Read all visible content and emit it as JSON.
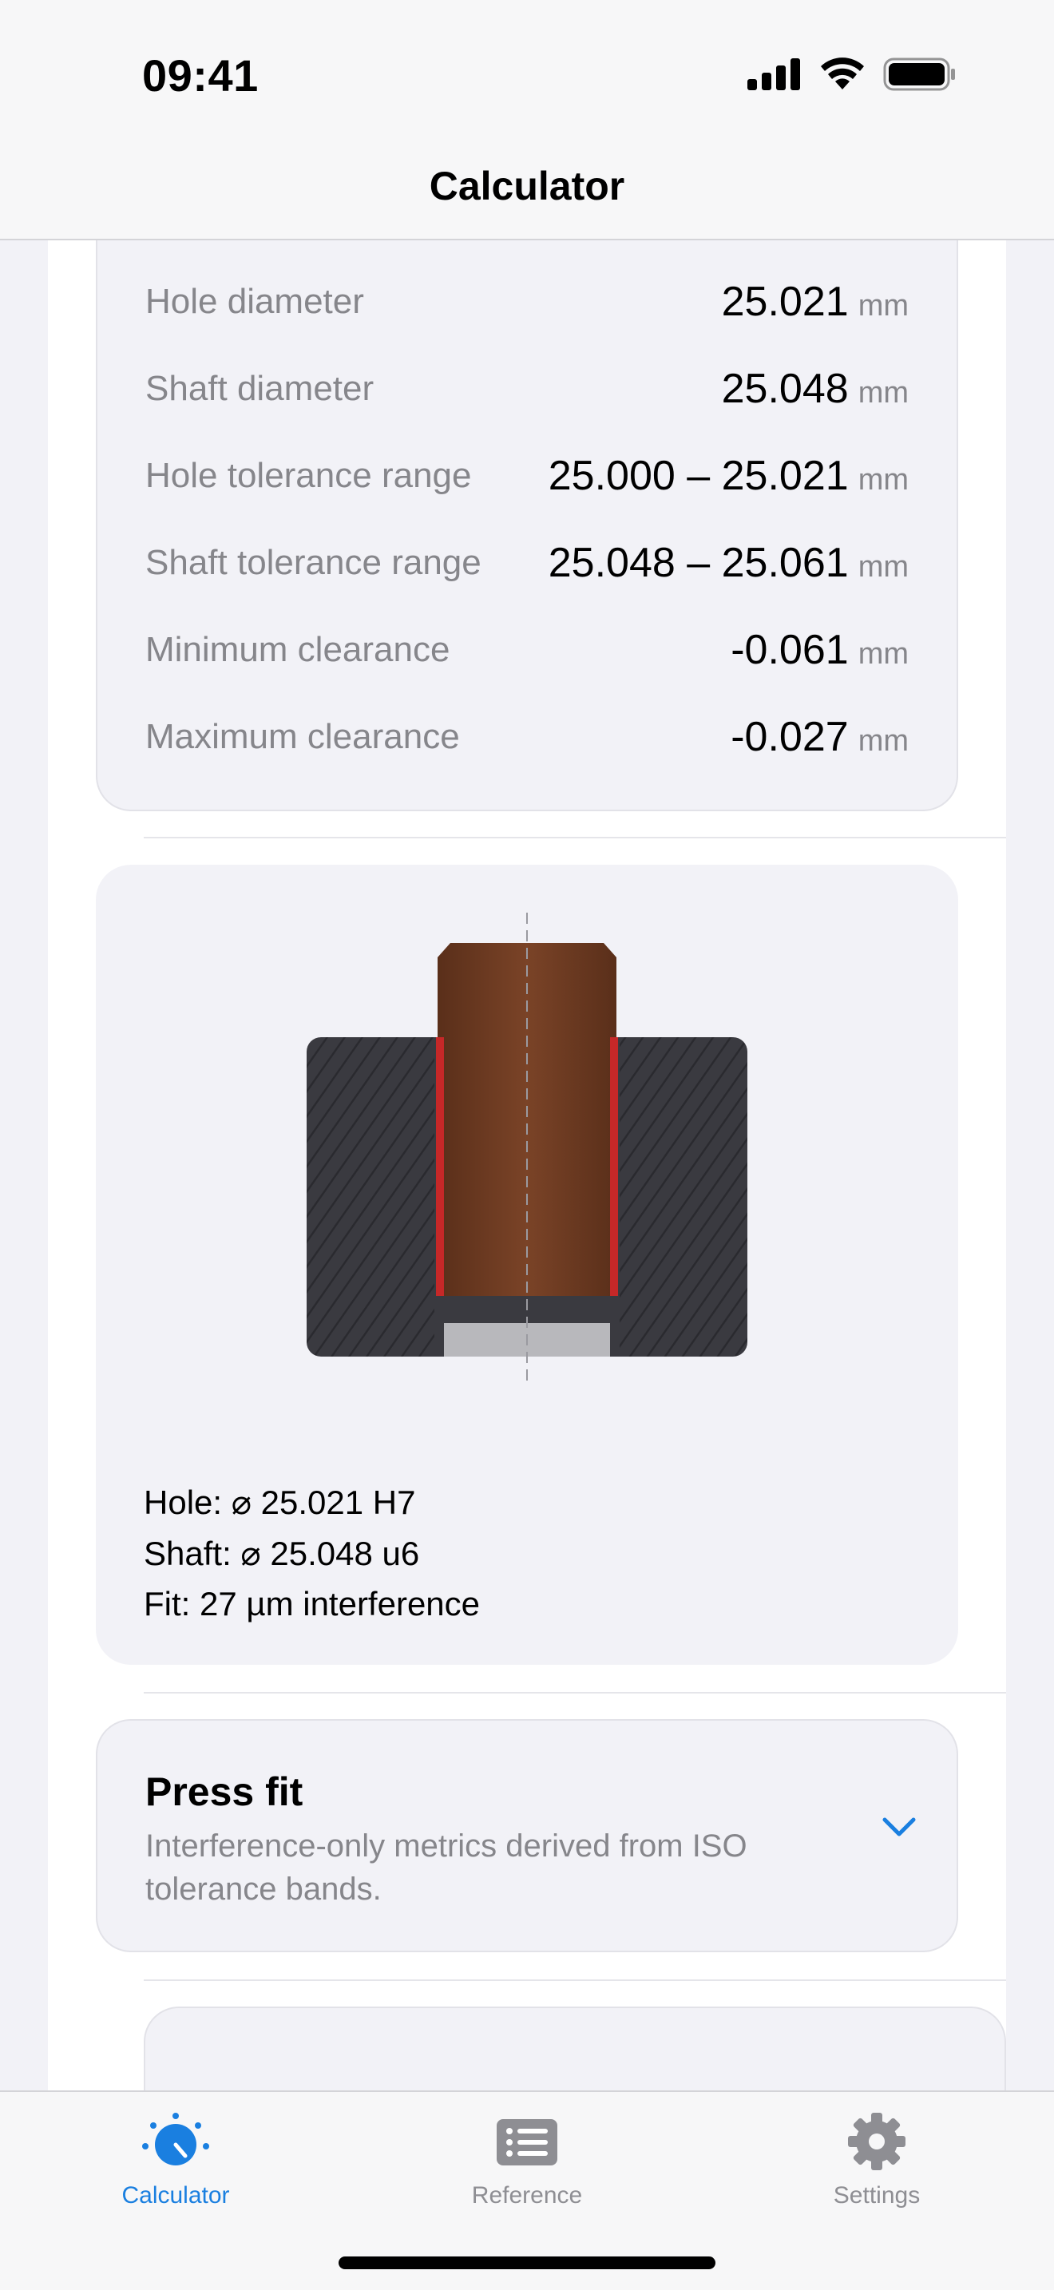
{
  "status_bar": {
    "time": "09:41"
  },
  "nav": {
    "title": "Calculator"
  },
  "results": [
    {
      "label": "Hole diameter",
      "value": "25.021",
      "unit": "mm"
    },
    {
      "label": "Shaft diameter",
      "value": "25.048",
      "unit": "mm"
    },
    {
      "label": "Hole tolerance range",
      "value": "25.000 – 25.021",
      "unit": "mm"
    },
    {
      "label": "Shaft tolerance range",
      "value": "25.048 – 25.061",
      "unit": "mm"
    },
    {
      "label": "Minimum clearance",
      "value": "-0.061",
      "unit": "mm"
    },
    {
      "label": "Maximum clearance",
      "value": "-0.027",
      "unit": "mm"
    }
  ],
  "diagram": {
    "captions": {
      "hole": "Hole: ⌀ 25.021 H7",
      "shaft": "Shaft: ⌀ 25.048 u6",
      "fit": "Fit: 27 µm interference"
    },
    "colors": {
      "housing": "#3a3a40",
      "shaft": "#6b3a22",
      "interference": "#c62828",
      "base": "#b8b8bc"
    }
  },
  "press_fit": {
    "title": "Press fit",
    "description": "Interference-only metrics derived from ISO tolerance bands."
  },
  "tabbar": {
    "tabs": [
      {
        "label": "Calculator",
        "icon": "gauge-icon",
        "active": true
      },
      {
        "label": "Reference",
        "icon": "list-icon",
        "active": false
      },
      {
        "label": "Settings",
        "icon": "gear-icon",
        "active": false
      }
    ]
  },
  "colors": {
    "accent": "#1a7fe0",
    "background": "#f2f2f7",
    "secondary_text": "#86868b"
  }
}
